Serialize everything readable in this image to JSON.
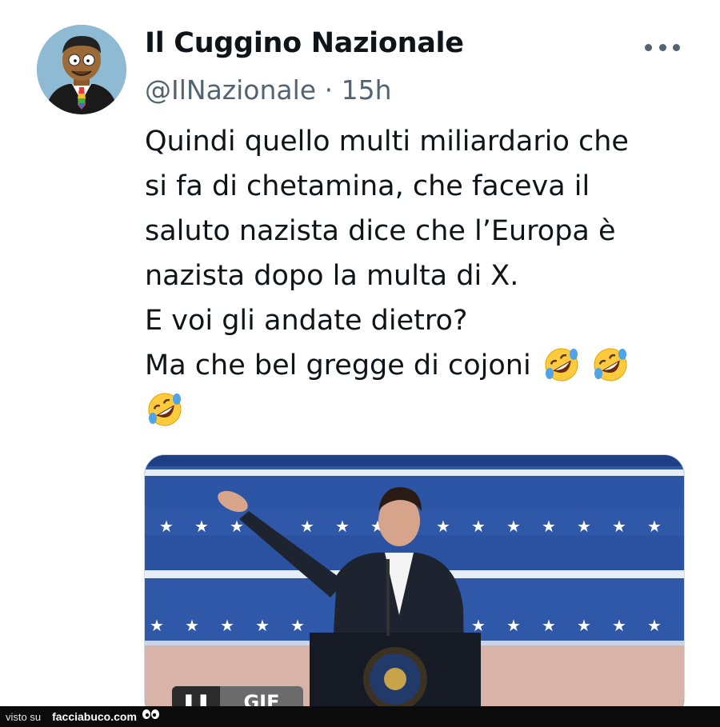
{
  "tweet": {
    "display_name": "Il Cuggino Nazionale",
    "handle": "@IlNazionale",
    "separator": "·",
    "time": "15h",
    "text_lines": [
      "Quindi quello multi miliardario che",
      "si fa di chetamina, che faceva il",
      "saluto nazista dice che l’Europa è",
      "nazista dopo la multa di X.",
      "E voi gli andate dietro?",
      "Ma che bel gregge di cojoni"
    ],
    "emoji": "rolling-on-floor-laughing",
    "emoji_count": 3
  },
  "media": {
    "type": "gif",
    "pause_icon": "pause-icon",
    "badge_label": "GIF"
  },
  "footer": {
    "prefix": "visto su",
    "site": "facciabuco.com",
    "logo_icon": "eyes-icon"
  },
  "colors": {
    "text": "#0f1419",
    "secondary_text": "#536471",
    "footer_bg": "#0b0b0b"
  }
}
